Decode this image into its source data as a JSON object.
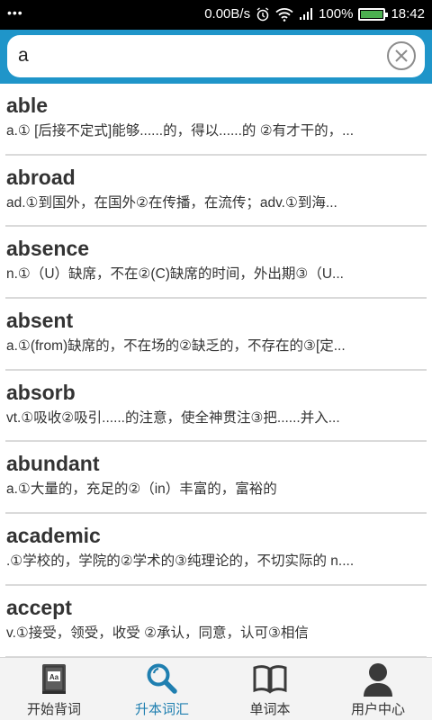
{
  "status_bar": {
    "dots": "•••",
    "speed": "0.00B/s",
    "battery": "100%",
    "time": "18:42",
    "battery_level": 1.0
  },
  "search": {
    "value": "a"
  },
  "entries": [
    {
      "word": "able",
      "definition": "a.① [后接不定式]能够......的，得以......的 ②有才干的，..."
    },
    {
      "word": "abroad",
      "definition": " ad.①到国外，在国外②在传播，在流传；adv.①到海..."
    },
    {
      "word": "absence",
      "definition": "n.①（U）缺席，不在②(C)缺席的时间，外出期③（U..."
    },
    {
      "word": "absent",
      "definition": " a.①(from)缺席的，不在场的②缺乏的，不存在的③[定..."
    },
    {
      "word": "absorb",
      "definition": " vt.①吸收②吸引......的注意，使全神贯注③把......并入..."
    },
    {
      "word": "abundant",
      "definition": "a.①大量的，充足的②（in）丰富的，富裕的"
    },
    {
      "word": "academic",
      "definition": ".①学校的，学院的②学术的③纯理论的，不切实际的 n...."
    },
    {
      "word": "accept",
      "definition": " v.①接受，领受，收受 ②承认，同意，认可③相信"
    }
  ],
  "nav": [
    {
      "label": "开始背词",
      "icon": "vocabulary-book-icon",
      "active": false
    },
    {
      "label": "升本词汇",
      "icon": "search-magnifier-icon",
      "active": true
    },
    {
      "label": "单词本",
      "icon": "open-book-icon",
      "active": false
    },
    {
      "label": "用户中心",
      "icon": "user-icon",
      "active": false
    }
  ],
  "colors": {
    "header": "#1f95c9",
    "active_nav": "#1f7fb0"
  }
}
